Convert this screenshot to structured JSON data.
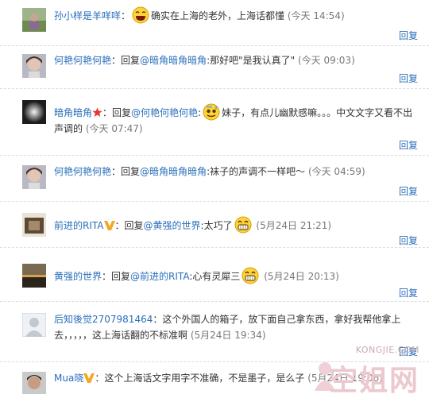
{
  "reply_label": "回复",
  "colors": {
    "link": "#2a6ebb",
    "text": "#333333",
    "time": "#777777",
    "divider": "#dcdcdc"
  },
  "comments": [
    {
      "name": "孙小样是羊咩咩",
      "sep": "：",
      "emoji": "laughing-emoji",
      "text": "确实在上海的老外，上海话都懂",
      "time": "(今天 14:54)"
    },
    {
      "name": "何艳何艳何艳",
      "sep": "：",
      "reply_prefix": "回复",
      "mention": "@暗角暗角暗角",
      "text": ":那好吧\"是我认真了\"",
      "time": "(今天 09:03)"
    },
    {
      "name": "暗角暗角",
      "badge": "star-badge",
      "sep": "：",
      "reply_prefix": "回复",
      "mention": "@何艳何艳何艳",
      "text": ":",
      "emoji": "sweat-emoji",
      "text2": "妹子，有点儿幽默感嘛。。。中文文字又看不出声调的",
      "time": "(今天 07:47)"
    },
    {
      "name": "何艳何艳何艳",
      "sep": "：",
      "reply_prefix": "回复",
      "mention": "@暗角暗角暗角",
      "text": ":袜子的声调不一样吧～",
      "time": "(今天 04:59)"
    },
    {
      "name": "前进的RITA",
      "badge": "v-badge",
      "sep": "：",
      "reply_prefix": "回复",
      "mention": "@黄强的世界",
      "text": ":太巧了",
      "emoji": "grin-emoji",
      "time": "(5月24日 21:21)"
    },
    {
      "name": "黄强的世界",
      "sep": "：",
      "reply_prefix": "回复",
      "mention": "@前进的RITA",
      "text": ":心有灵犀三",
      "emoji": "grin-emoji",
      "time": "(5月24日 20:13)"
    },
    {
      "name": "后知後觉2707981464",
      "sep": "：",
      "text": "这个外国人的箱子，放下面自己拿东西，拿好我帮他拿上去，，，，，这上海话翻的不标准啊",
      "time": "(5月24日 19:34)"
    },
    {
      "name": "Mua晓",
      "badge": "v-badge",
      "sep": "：",
      "text": "这个上海话文字用字不准确，不是墨子，是么子",
      "time": "(5月24日 19:06)"
    }
  ],
  "watermark": {
    "url": "KONGJIE.COM",
    "title": "空姐网"
  }
}
